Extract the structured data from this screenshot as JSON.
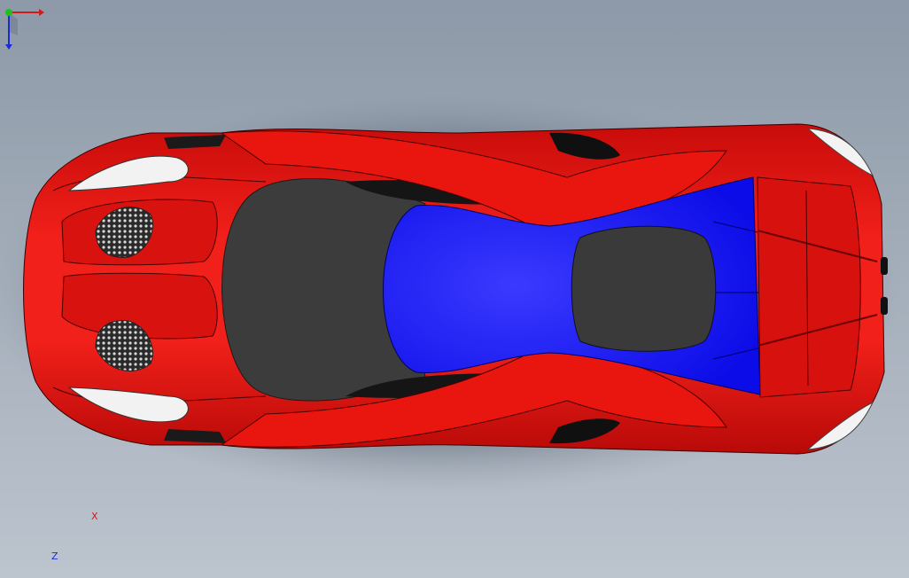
{
  "viewport": {
    "background_top": "#8d99a8",
    "background_bottom": "#bcc4ce"
  },
  "model": {
    "body_color": "#e3120f",
    "canopy_color": "#2f3a90",
    "accent_color": "#1313ff",
    "glass_color": "#3a3a3a"
  },
  "triad": {
    "x_label": "X",
    "z_label": "Z",
    "x_color": "#d21a1a",
    "y_color": "#1fbf1f",
    "z_color": "#1a2bd2"
  }
}
